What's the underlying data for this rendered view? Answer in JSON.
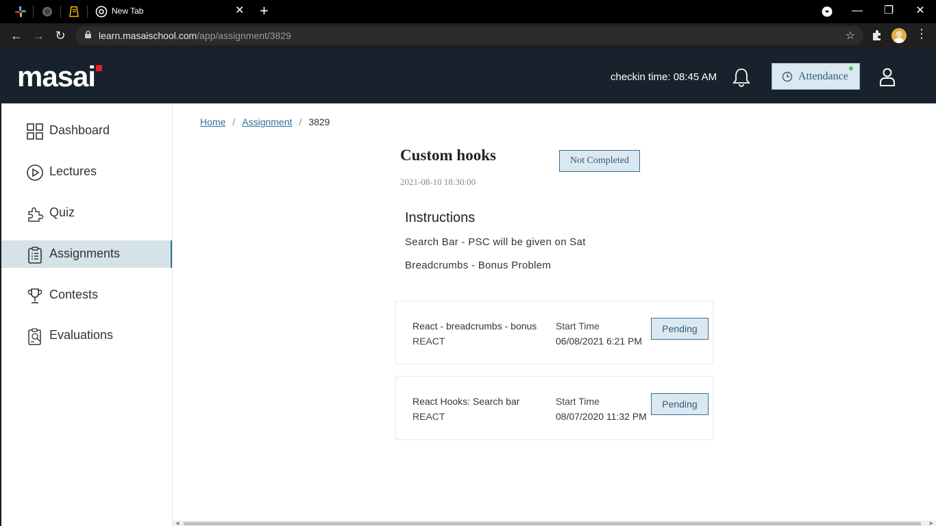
{
  "browser": {
    "tab_title": "New Tab",
    "url_host": "learn.masaischool.com",
    "url_path": "/app/assignment/3829"
  },
  "header": {
    "logo_text": "masai",
    "checkin": "checkin time: 08:45 AM",
    "attendance_label": "Attendance"
  },
  "sidebar": {
    "items": [
      {
        "label": "Dashboard",
        "icon": "dashboard-icon"
      },
      {
        "label": "Lectures",
        "icon": "play-circle-icon"
      },
      {
        "label": "Quiz",
        "icon": "puzzle-icon"
      },
      {
        "label": "Assignments",
        "icon": "clipboard-icon",
        "active": true
      },
      {
        "label": "Contests",
        "icon": "trophy-icon"
      },
      {
        "label": "Evaluations",
        "icon": "evaluation-icon"
      }
    ]
  },
  "breadcrumb": {
    "home": "Home",
    "assignment": "Assignment",
    "current": "3829",
    "separator": "/"
  },
  "assignment": {
    "title": "Custom hooks",
    "status": "Not Completed",
    "date": "2021-08-10 18:30:00",
    "instructions_title": "Instructions",
    "instructions": [
      "Search Bar - PSC will be given on Sat",
      "Breadcrumbs - Bonus Problem"
    ]
  },
  "problems": [
    {
      "name": "React - breadcrumbs - bonus",
      "category": "REACT",
      "start_label": "Start Time",
      "start_time": "06/08/2021 6:21 PM",
      "status": "Pending"
    },
    {
      "name": "React Hooks: Search bar",
      "category": "REACT",
      "start_label": "Start Time",
      "start_time": "08/07/2020 11:32 PM",
      "status": "Pending"
    }
  ],
  "colors": {
    "header_bg": "#17222c",
    "accent": "#2f6f96",
    "badge_bg": "#dce8f0",
    "logo_red": "#ed1c24"
  }
}
